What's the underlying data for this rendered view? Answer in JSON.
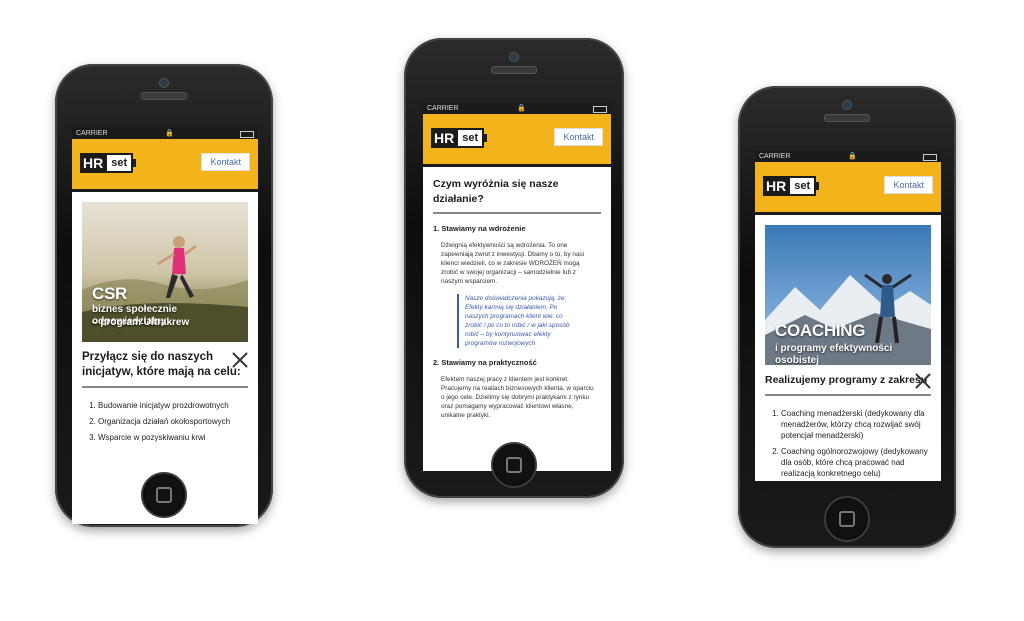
{
  "statusbar": {
    "carrier": "CARRIER",
    "lock": "🔒"
  },
  "brand": {
    "hr": "HR",
    "set": "set",
    "contact": "Kontakt",
    "accent": "#f3b31b"
  },
  "phone1": {
    "hero_title": "CSR",
    "hero_sub_line1": "biznes społecznie odpowiedzialny",
    "hero_sub_line2": "– program Ultrakrew",
    "section_line1": "Przyłącz się do naszych",
    "section_line2": "inicjatyw, które mają na celu:",
    "items": [
      "Budowanie inicjatyw prozdrowotnych",
      "Organizacja działań okołosportowych",
      "Wsparcie w pozyskiwaniu krwi"
    ]
  },
  "phone2": {
    "heading": "Czym wyróżnia się nasze działanie?",
    "s1_title": "1. Stawiamy na wdrożenie",
    "s1_text": "Dźwignią efektywności są wdrożenia. To one zapewniają zwrot z inwestycji. Dbamy o to, by nasi klienci wiedzieli, co w zakresie WDROŻEŃ mogą zrobić w swojej organizacji – samodzielnie lub z naszym wsparciem.",
    "quote": "Nasze doświadczenia pokazują, że: Efekty karmią się działaniem. Po naszych programach klient wie: co zrobić / po co to robić / w jaki sposób robić – by kontynuować efekty programów rozwojowych",
    "s2_title": "2. Stawiamy na praktyczność",
    "s2_text": "Efektem naszej pracy z klientem jest konkret. Pracujemy na realiach biznesowych klienta, w oparciu o jego cele. Dzielimy się dobrymi praktykami z rynku oraz pomagamy wypracować klientowi własne, unikalne praktyki."
  },
  "phone3": {
    "hero_title": "COACHING",
    "hero_sub": "i programy efektywności osobistej",
    "section": "Realizujemy programy z zakresu",
    "items": [
      "Coaching menadżerski (dedykowany dla menadżerów, którzy chcą rozwijać swój potencjał menadżerski)",
      "Coaching ogólnorozwojowy (dedykowany dla osób, które chcą pracować nad realizacją konkretnego celu)"
    ]
  }
}
